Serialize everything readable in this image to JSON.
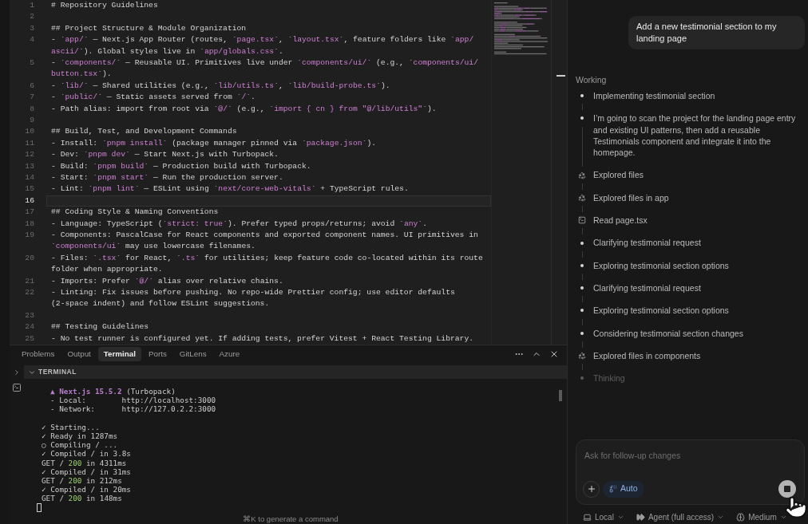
{
  "editor": {
    "lines": [
      {
        "number": "1",
        "rows": [
          "# Repository Guidelines"
        ],
        "current": false
      },
      {
        "number": "2",
        "current": false
      },
      {
        "number": "3",
        "rows": [
          "## Project Structure & Module Organization"
        ],
        "current": false
      },
      {
        "number": "4",
        "rows": [
          "- `app/` — Next.js App Router (routes, `page.tsx`, `layout.tsx`, feature folders like `app/",
          "ascii/`). Global styles live in `app/globals.css`."
        ],
        "current": false
      },
      {
        "number": "5",
        "rows": [
          "- `components/` — Reusable UI. Primitives live under `components/ui/` (e.g., `components/ui/",
          "button.tsx`)."
        ],
        "current": false
      },
      {
        "number": "6",
        "rows": [
          "- `lib/` — Shared utilities (e.g., `lib/utils.ts`, `lib/build-probe.ts`)."
        ],
        "current": false
      },
      {
        "number": "7",
        "rows": [
          "- `public/` — Static assets served from `/`."
        ],
        "current": false
      },
      {
        "number": "8",
        "rows": [
          "- Path alias: import from root via `@/` (e.g., `import { cn } from \"@/lib/utils\"`)."
        ],
        "current": false
      },
      {
        "number": "9",
        "current": false
      },
      {
        "number": "10",
        "rows": [
          "## Build, Test, and Development Commands"
        ],
        "current": false
      },
      {
        "number": "11",
        "rows": [
          "- Install: `pnpm install` (package manager pinned via `package.json`)."
        ],
        "current": false
      },
      {
        "number": "12",
        "rows": [
          "- Dev: `pnpm dev` — Start Next.js with Turbopack."
        ],
        "current": false
      },
      {
        "number": "13",
        "rows": [
          "- Build: `pnpm build` — Production build with Turbopack."
        ],
        "current": false
      },
      {
        "number": "14",
        "rows": [
          "- Start: `pnpm start` — Run the production server."
        ],
        "current": false
      },
      {
        "number": "15",
        "rows": [
          "- Lint: `pnpm lint` — ESLint using `next/core-web-vitals` + TypeScript rules."
        ],
        "current": false
      },
      {
        "number": "16",
        "current": true
      },
      {
        "number": "17",
        "rows": [
          "## Coding Style & Naming Conventions"
        ],
        "current": false
      },
      {
        "number": "18",
        "rows": [
          "- Language: TypeScript (`strict: true`). Prefer typed props/returns; avoid `any`."
        ],
        "current": false
      },
      {
        "number": "19",
        "rows": [
          "- Components: PascalCase for React components and exported component names. UI primitives in",
          "`components/ui` may use lowercase filenames."
        ],
        "current": false
      },
      {
        "number": "20",
        "rows": [
          "- Files: `.tsx` for React, `.ts` for utilities; keep feature code co-located within its route",
          "folder when appropriate."
        ],
        "current": false
      },
      {
        "number": "21",
        "rows": [
          "- Imports: Prefer `@/` alias over relative chains."
        ],
        "current": false
      },
      {
        "number": "22",
        "rows": [
          "- Linting: Fix issues before pushing. No repo-wide Prettier config; use editor defaults",
          "(2-space indent) and follow ESLint suggestions."
        ],
        "current": false
      },
      {
        "number": "23",
        "current": false
      },
      {
        "number": "24",
        "rows": [
          "## Testing Guidelines"
        ],
        "current": false
      },
      {
        "number": "25",
        "rows": [
          "- No test runner is configured yet. If adding tests, prefer Vitest + React Testing Library."
        ],
        "current": false
      }
    ]
  },
  "panel": {
    "tabs": [
      {
        "label": "Problems",
        "selected": false
      },
      {
        "label": "Output",
        "selected": false
      },
      {
        "label": "Terminal",
        "selected": true
      },
      {
        "label": "Ports",
        "selected": false
      },
      {
        "label": "GitLens",
        "selected": false
      },
      {
        "label": "Azure",
        "selected": false
      }
    ],
    "section": {
      "title": "TERMINAL",
      "expanded": true
    },
    "terminal": {
      "banner": [
        {
          "segments": [
            {
              "text": "▲ Next.js 15.5.2",
              "kind": "accent"
            },
            {
              "text": " (Turbopack)",
              "kind": "plain"
            }
          ]
        },
        {
          "segments": [
            {
              "text": "- Local:        http://localhost:3000",
              "kind": "plain"
            }
          ]
        },
        {
          "segments": [
            {
              "text": "- Network:      http://127.0.2.2:3000",
              "kind": "plain"
            }
          ]
        }
      ],
      "log": [
        {
          "segments": [
            {
              "text": "✓ Starting...",
              "kind": "plain"
            }
          ]
        },
        {
          "segments": [
            {
              "text": "✓ Ready in 1287ms",
              "kind": "plain"
            }
          ]
        },
        {
          "segments": [
            {
              "text": "○ Compiling / ...",
              "kind": "plain"
            }
          ]
        },
        {
          "segments": [
            {
              "text": "✓ Compiled / in 3.8s",
              "kind": "plain"
            }
          ]
        },
        {
          "segments": [
            {
              "text": "GET / ",
              "kind": "plain"
            },
            {
              "text": "200",
              "kind": "success"
            },
            {
              "text": " in 4311ms",
              "kind": "plain"
            }
          ]
        },
        {
          "segments": [
            {
              "text": "✓ Compiled / in 31ms",
              "kind": "plain"
            }
          ]
        },
        {
          "segments": [
            {
              "text": "GET / ",
              "kind": "plain"
            },
            {
              "text": "200",
              "kind": "success"
            },
            {
              "text": " in 212ms",
              "kind": "plain"
            }
          ]
        },
        {
          "segments": [
            {
              "text": "✓ Compiled / in 20ms",
              "kind": "plain"
            }
          ]
        },
        {
          "segments": [
            {
              "text": "GET / ",
              "kind": "plain"
            },
            {
              "text": "200",
              "kind": "success"
            },
            {
              "text": " in 148ms",
              "kind": "plain"
            }
          ]
        }
      ],
      "hint": "⌘K to generate a command"
    }
  },
  "chat": {
    "user_message": "Add a new testimonial section to my landing page",
    "status": "Working",
    "steps": [
      {
        "kind": "step",
        "text": "Implementing testimonial section"
      },
      {
        "kind": "step",
        "text": "I’m going to scan the project for the landing page entry and existing UI patterns, then add a reusable Testimonials component and integrate it into the homepage."
      },
      {
        "kind": "explore",
        "text": "Explored files"
      },
      {
        "kind": "explore",
        "text": "Explored files in app"
      },
      {
        "kind": "read",
        "text": "Read page.tsx"
      },
      {
        "kind": "step",
        "text": "Clarifying testimonial request"
      },
      {
        "kind": "step",
        "text": "Exploring testimonial section options"
      },
      {
        "kind": "step",
        "text": "Clarifying testimonial request"
      },
      {
        "kind": "step",
        "text": "Exploring testimonial section options"
      },
      {
        "kind": "step",
        "text": "Considering testimonial section changes"
      },
      {
        "kind": "explore",
        "text": "Explored files in components"
      },
      {
        "kind": "thinking",
        "text": "Thinking"
      }
    ],
    "composer": {
      "placeholder": "Ask for follow-up changes",
      "mode": "Auto"
    },
    "footer": [
      {
        "kind": "environment",
        "label": "Local"
      },
      {
        "kind": "access",
        "label": "Agent (full access)"
      },
      {
        "kind": "reasoning",
        "label": "Medium"
      }
    ]
  }
}
